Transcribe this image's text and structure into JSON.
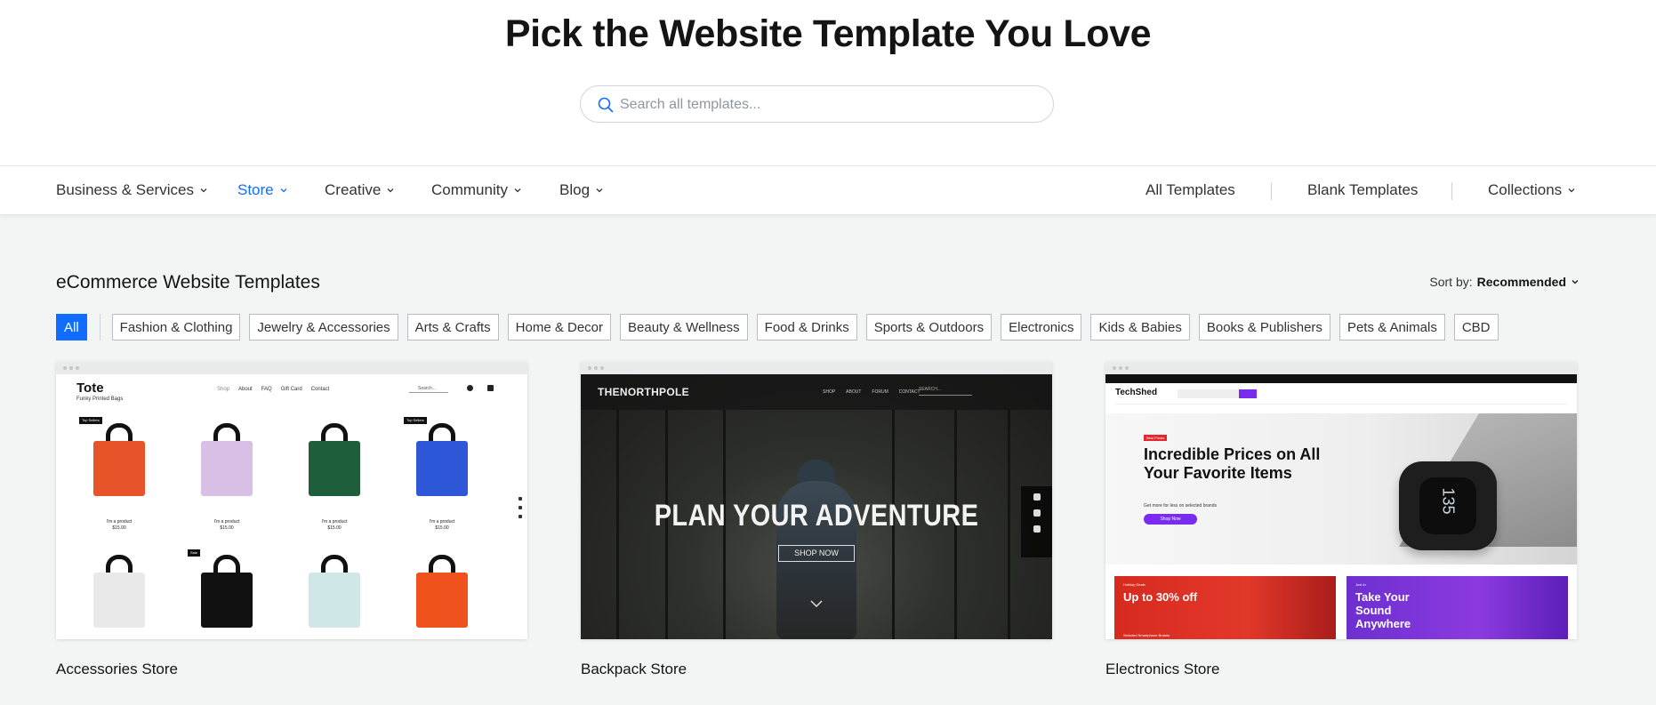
{
  "hero": {
    "title": "Pick the Website Template You Love",
    "search_placeholder": "Search all templates..."
  },
  "nav": {
    "left": [
      {
        "label": "Business & Services",
        "active": false
      },
      {
        "label": "Store",
        "active": true
      },
      {
        "label": "Creative",
        "active": false
      },
      {
        "label": "Community",
        "active": false
      },
      {
        "label": "Blog",
        "active": false
      }
    ],
    "right": [
      {
        "label": "All Templates"
      },
      {
        "label": "Blank Templates"
      },
      {
        "label": "Collections"
      }
    ]
  },
  "section": {
    "title": "eCommerce Website Templates",
    "sort_label": "Sort by:",
    "sort_value": "Recommended"
  },
  "filters": [
    "All",
    "Fashion & Clothing",
    "Jewelry & Accessories",
    "Arts & Crafts",
    "Home & Decor",
    "Beauty & Wellness",
    "Food & Drinks",
    "Sports & Outdoors",
    "Electronics",
    "Kids & Babies",
    "Books & Publishers",
    "Pets & Animals",
    "CBD"
  ],
  "cards": [
    {
      "label": "Accessories Store",
      "preview": {
        "logo": "Tote",
        "tagline": "Funky Printed Bags",
        "menu": [
          "Shop",
          "About",
          "FAQ",
          "Gift Card",
          "Contact"
        ],
        "search": "Search...",
        "badge_top": "Top Sellers",
        "badge_sale": "Sale",
        "product_name": "I'm a product",
        "product_price": "$15.00"
      }
    },
    {
      "label": "Backpack Store",
      "preview": {
        "logo": "THENORTHPOLE",
        "menu": [
          "SHOP",
          "ABOUT",
          "FORUM",
          "CONTACT"
        ],
        "search": "SEARCH...",
        "headline": "PLAN YOUR ADVENTURE",
        "button": "SHOP NOW"
      }
    },
    {
      "label": "Electronics Store",
      "preview": {
        "logo": "TechShed",
        "badge": "Best Prices",
        "headline": "Incredible Prices on All Your Favorite Items",
        "sub": "Get more for less on selected brands",
        "button": "Shop Now",
        "watch_text": "135",
        "banner1_tag": "Holiday Deals",
        "banner1_title": "Up to 30% off",
        "banner1_sub": "Selected Smartphone Brands",
        "banner2_tag": "Just In",
        "banner2_title": "Take Your Sound Anywhere"
      }
    }
  ],
  "colors": {
    "accent": "#116dff",
    "page_bg": "#f3f5f4",
    "purple": "#7a2bf0"
  }
}
